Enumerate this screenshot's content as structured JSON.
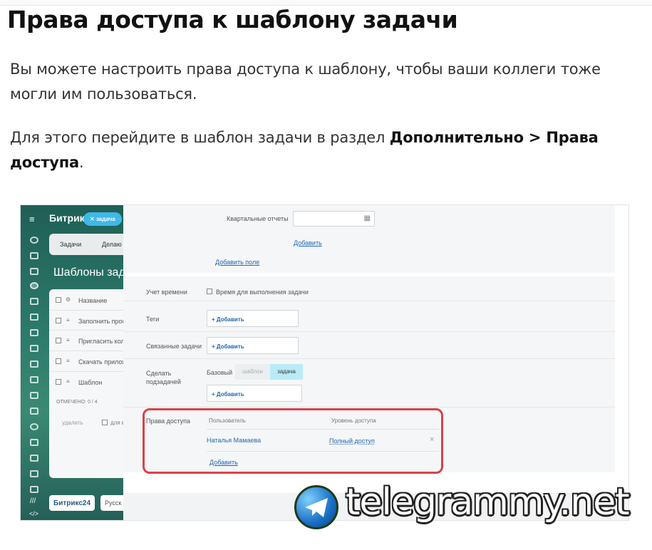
{
  "heading": "Права доступа к шаблону задачи",
  "paragraph1": "Вы можете настроить права доступа к шаблону, чтобы ваши коллеги тоже могли им пользоваться.",
  "paragraph2_prefix": "Для этого перейдите в шаблон задачи в раздел ",
  "paragraph2_bold": "Дополнительно > Права доступа",
  "paragraph2_suffix": ".",
  "screenshot": {
    "left_sidebar": {
      "brand": "Битрикс",
      "chip": "задача",
      "tabs": [
        "Задачи",
        "Делаю"
      ],
      "page_title": "Шаблоны зада",
      "list_header": "Название",
      "list_items": [
        "Заполнить проф",
        "Пригласить колл",
        "Скачать прилож",
        "Шаблон"
      ],
      "selected": "ОТМЕЧЕНО: 0 / 4",
      "delete_label": "удалить",
      "for_all_label": "для в",
      "footer_brand": "Битрикс24",
      "footer_lang": "Русск"
    },
    "form": {
      "quarterly_label": "Квартальные отчеты",
      "add_link": "Добавить",
      "add_field_link": "Добавить поле",
      "time_tracking_label": "Учет времени",
      "time_tracking_checkbox": "Время для выполнения задачи",
      "tags_label": "Теги",
      "add_btn": "+ Добавить",
      "related_label": "Связанные задачи",
      "subtask_label_1": "Сделать",
      "subtask_label_2": "подзадачей",
      "base_label": "Базовый",
      "toggle_template": "шаблон",
      "toggle_task": "задача",
      "access_label": "Права доступа",
      "col_user": "Пользователь",
      "col_level": "Уровень доступа",
      "user_name": "Наталья Мамаева",
      "access_level": "Полный доступ",
      "remove": "×",
      "add_user": "Добавить"
    }
  },
  "watermark": "telegrammy.net",
  "colors": {
    "highlight": "#d8424a",
    "link": "#2067b0",
    "sidebar": "#2c7a6a",
    "chip": "#3fb8e8"
  }
}
